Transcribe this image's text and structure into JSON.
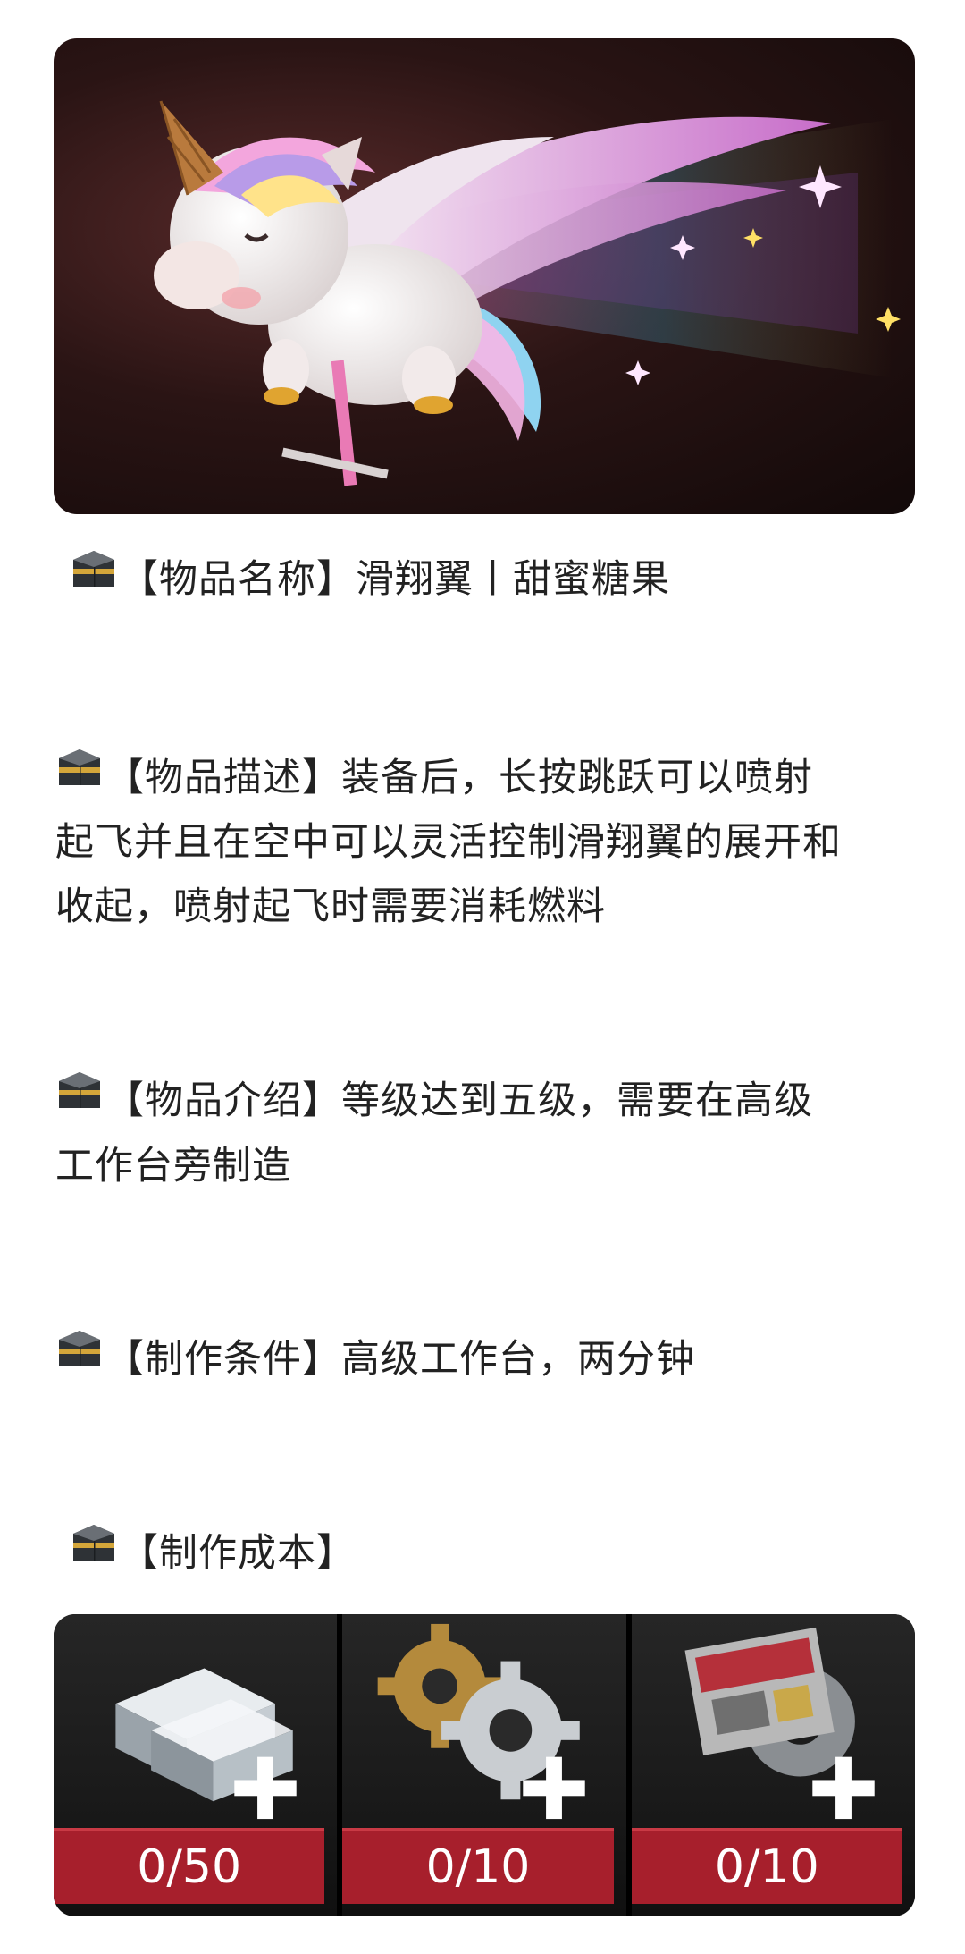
{
  "hero": {
    "alt": "滑翔翼丨甜蜜糖果"
  },
  "lines": {
    "name": "【物品名称】滑翔翼丨甜蜜糖果",
    "desc_1": "【物品描述】装备后，长按跳跃可以喷射",
    "desc_2": "起飞并且在空中可以灵活控制滑翔翼的展开和",
    "desc_3": "收起，喷射起飞时需要消耗燃料",
    "intro_1": "【物品介绍】等级达到五级，需要在高级",
    "intro_2": "工作台旁制造",
    "condition": "【制作条件】高级工作台，两分钟",
    "cost_title": "【制作成本】"
  },
  "costs": [
    {
      "icon": "metal-ingot-icon",
      "count": "0/50"
    },
    {
      "icon": "gear-parts-icon",
      "count": "0/10"
    },
    {
      "icon": "circuit-parts-icon",
      "count": "0/10"
    }
  ],
  "colors": {
    "count_bg": "#a71f2c",
    "hero_bg": "#1a0c0c"
  }
}
